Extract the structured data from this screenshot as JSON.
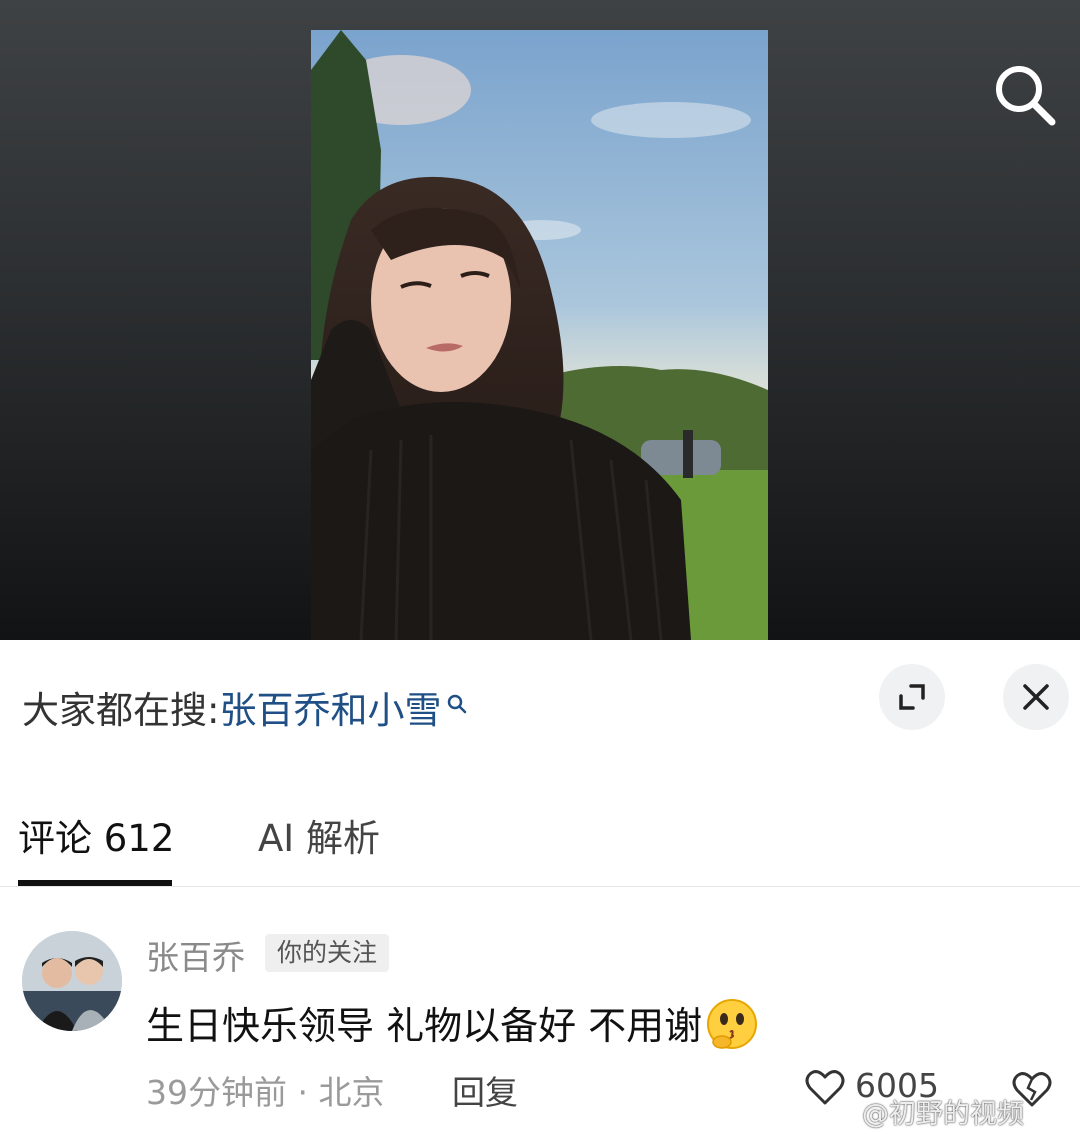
{
  "video": {
    "search_icon": "search-icon"
  },
  "hot_search": {
    "prefix": "大家都在搜:",
    "term": "张百乔和小雪",
    "term_icon": "search-icon-small"
  },
  "panel_controls": {
    "expand_icon": "expand-icon",
    "close_icon": "close-icon"
  },
  "tabs": [
    {
      "label": "评论 612",
      "active": true
    },
    {
      "label": "AI 解析",
      "active": false
    }
  ],
  "comment": {
    "author": "张百乔",
    "badge": "你的关注",
    "text": "生日快乐领导 礼物以备好 不用谢",
    "emoji": "thinking-kiss-emoji",
    "time_location": "39分钟前 · 北京",
    "reply_label": "回复",
    "like_count": "6005",
    "like_icon": "heart-outline-icon",
    "dislike_icon": "broken-heart-icon"
  },
  "watermark": {
    "text": "@初野的视频",
    "logo": "weibo-logo"
  },
  "colors": {
    "link": "#1f4f85",
    "tab_underline": "#111111"
  }
}
